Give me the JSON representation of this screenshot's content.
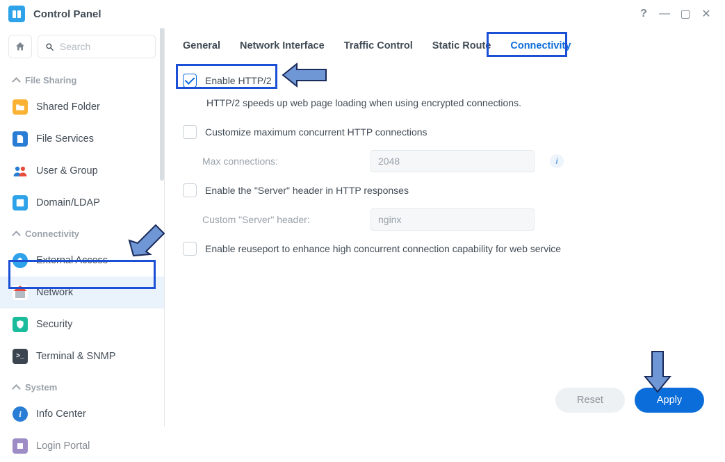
{
  "window": {
    "title": "Control Panel"
  },
  "search": {
    "placeholder": "Search"
  },
  "sidebar": {
    "groups": [
      {
        "label": "File Sharing"
      },
      {
        "label": "Connectivity"
      },
      {
        "label": "System"
      }
    ],
    "items": {
      "shared_folder": "Shared Folder",
      "file_services": "File Services",
      "user_group": "User & Group",
      "domain_ldap": "Domain/LDAP",
      "external_access": "External Access",
      "network": "Network",
      "security": "Security",
      "terminal_snmp": "Terminal & SNMP",
      "info_center": "Info Center",
      "login_portal": "Login Portal"
    }
  },
  "tabs": {
    "general": "General",
    "network_interface": "Network Interface",
    "traffic_control": "Traffic Control",
    "static_route": "Static Route",
    "connectivity": "Connectivity"
  },
  "form": {
    "enable_http2": "Enable HTTP/2",
    "http2_desc": "HTTP/2 speeds up web page loading when using encrypted connections.",
    "customize_max": "Customize maximum concurrent HTTP connections",
    "max_conn_label": "Max connections:",
    "max_conn_value": "2048",
    "enable_server_header": "Enable the \"Server\" header in HTTP responses",
    "custom_server_label": "Custom \"Server\" header:",
    "custom_server_value": "nginx",
    "enable_reuseport": "Enable reuseport to enhance high concurrent connection capability for web service"
  },
  "footer": {
    "reset": "Reset",
    "apply": "Apply"
  }
}
